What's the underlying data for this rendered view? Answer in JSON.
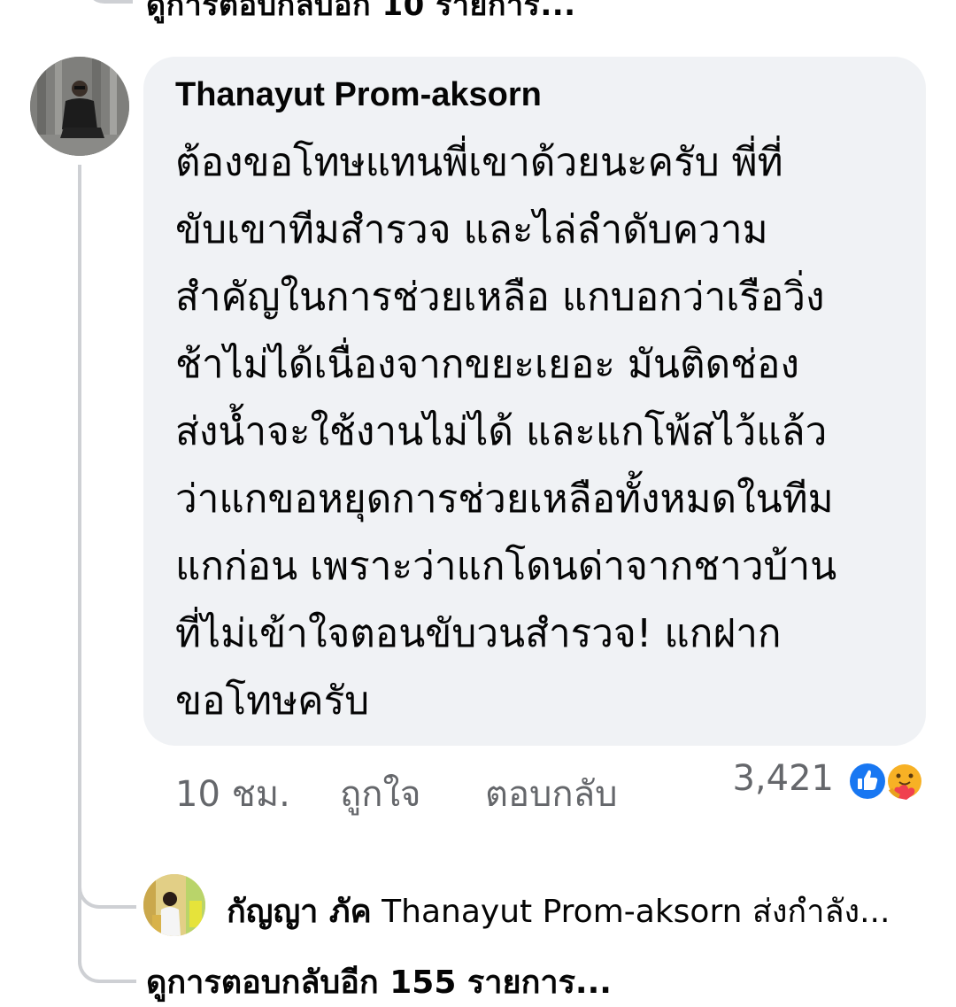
{
  "top_link_text": "ดูการตอบกลับอีก 10 รายการ...",
  "comment": {
    "author": "Thanayut Prom-aksorn",
    "lines": [
      "ต้องขอโทษแทนพี่เขาด้วยนะครับ พี่ที่",
      "ขับเขาทีมสำรวจ และไล่ลำดับความ",
      "สำคัญในการช่วยเหลือ แกบอกว่าเรือวิ่ง",
      "ช้าไม่ได้เนื่องจากขยะเยอะ มันติดช่อง",
      "ส่งน้ำจะใช้งานไม่ได้ และแกโพ้สไว้แล้ว",
      "ว่าแกขอหยุดการช่วยเหลือทั้งหมดในทีม",
      "แกก่อน เพราะว่าแกโดนด่าจากชาวบ้าน",
      "ที่ไม่เข้าใจตอนขับวนสำรวจ! แกฝาก",
      "ขอโทษครับ"
    ],
    "time": "10 ชม.",
    "like_label": "ถูกใจ",
    "reply_label": "ตอบกลับ",
    "reaction_count": "3,421",
    "reaction_icons": [
      "like-icon",
      "care-icon"
    ]
  },
  "reply_preview": {
    "name": "กัญญา ภัค",
    "text": "Thanayut Prom-aksorn ส่งกำลัง..."
  },
  "more_replies_text": "ดูการตอบกลับอีก 155 รายการ...",
  "colors": {
    "bubble": "#f0f2f5",
    "meta_text": "#65676b",
    "thread_line": "#ced0d4",
    "like_blue": "#1877f2"
  }
}
